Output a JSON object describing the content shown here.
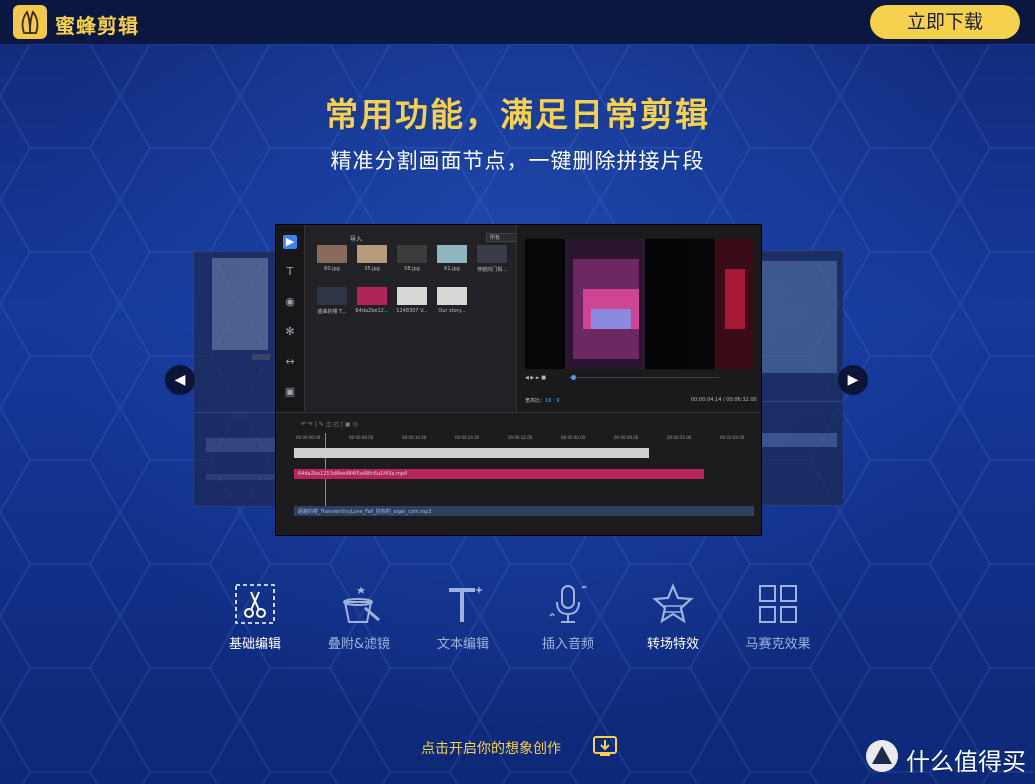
{
  "app": {
    "name": "蜜蜂剪辑",
    "download_label": "立即下载"
  },
  "hero": {
    "title": "常用功能，满足日常剪辑",
    "subtitle": "精准分割画面节点，一键删除拼接片段"
  },
  "carousel": {
    "prev_icon": "chevron-left-icon",
    "next_icon": "chevron-right-icon"
  },
  "editor": {
    "import_label": "导入",
    "filter_value": "所有",
    "media": [
      {
        "label": "60.jpg",
        "color": "#8a6a5a"
      },
      {
        "label": "35.jpg",
        "color": "#b59a7c"
      },
      {
        "label": "58.jpg",
        "color": "#3b3b3b"
      },
      {
        "label": "61.jpg",
        "color": "#8fb6bf"
      },
      {
        "label": "穿越的门相...",
        "color": "#3a3d48"
      },
      {
        "label": "盛曲的楼 T...",
        "color": "#2f3446"
      },
      {
        "label": "64da2be12...",
        "color": "#b0245a"
      },
      {
        "label": "1248307 V...",
        "color": "#d8d8d8"
      },
      {
        "label": "Our story...",
        "color": "#d8d8d8"
      }
    ],
    "aspect_label": "宽高比：",
    "aspect_value": "16 : 9",
    "time_readout": "00:00:04.14 / 00:06:32.00",
    "ruler": [
      "00:00:00.00",
      "00:00:08.00",
      "00:00:16.00",
      "00:00:24.00",
      "00:00:32.00",
      "00:00:40.00",
      "00:00:48.00",
      "00:00:56.00",
      "00:01:04.00"
    ],
    "video_track_label": "64da2be1253d4be484f5a48fc6a1f43a.mp4",
    "audio_track_label": "超越的楼_TransientinyLove_Fall_授权的_aigei_com.mp3"
  },
  "features": [
    {
      "label": "基础编辑",
      "icon": "scissors-icon",
      "active": true
    },
    {
      "label": "叠附&滤镜",
      "icon": "magic-hat-icon",
      "active": false
    },
    {
      "label": "文本编辑",
      "icon": "text-icon",
      "active": false
    },
    {
      "label": "插入音频",
      "icon": "microphone-icon",
      "active": false
    },
    {
      "label": "转场特效",
      "icon": "star-icon",
      "active": true
    },
    {
      "label": "马赛克效果",
      "icon": "mosaic-icon",
      "active": false
    }
  ],
  "cta": {
    "label": "点击开启你的想象创作",
    "icon": "download-icon"
  },
  "watermark": {
    "text": "什么值得买"
  },
  "colors": {
    "accent": "#f6d14d",
    "background": "#16389a",
    "topbar": "#0b1740"
  }
}
